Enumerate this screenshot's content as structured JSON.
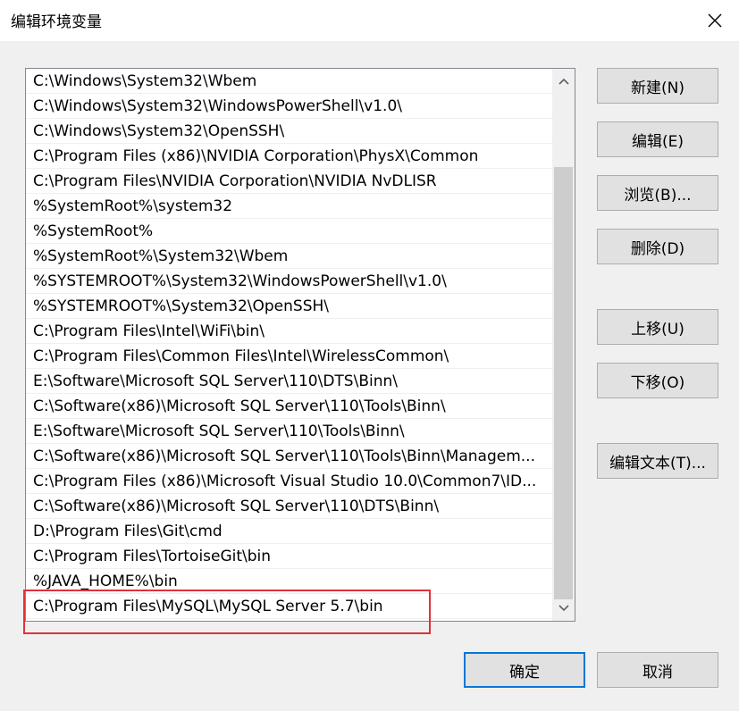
{
  "window": {
    "title": "编辑环境变量"
  },
  "path_list": {
    "entries": [
      "C:\\Windows\\System32\\Wbem",
      "C:\\Windows\\System32\\WindowsPowerShell\\v1.0\\",
      "C:\\Windows\\System32\\OpenSSH\\",
      "C:\\Program Files (x86)\\NVIDIA Corporation\\PhysX\\Common",
      "C:\\Program Files\\NVIDIA Corporation\\NVIDIA NvDLISR",
      "%SystemRoot%\\system32",
      "%SystemRoot%",
      "%SystemRoot%\\System32\\Wbem",
      "%SYSTEMROOT%\\System32\\WindowsPowerShell\\v1.0\\",
      "%SYSTEMROOT%\\System32\\OpenSSH\\",
      "C:\\Program Files\\Intel\\WiFi\\bin\\",
      "C:\\Program Files\\Common Files\\Intel\\WirelessCommon\\",
      "E:\\Software\\Microsoft SQL Server\\110\\DTS\\Binn\\",
      "C:\\Software(x86)\\Microsoft SQL Server\\110\\Tools\\Binn\\",
      "E:\\Software\\Microsoft SQL Server\\110\\Tools\\Binn\\",
      "C:\\Software(x86)\\Microsoft SQL Server\\110\\Tools\\Binn\\Managem...",
      "C:\\Program Files (x86)\\Microsoft Visual Studio 10.0\\Common7\\ID...",
      "C:\\Software(x86)\\Microsoft SQL Server\\110\\DTS\\Binn\\",
      "D:\\Program Files\\Git\\cmd",
      "C:\\Program Files\\TortoiseGit\\bin",
      "%JAVA_HOME%\\bin",
      "C:\\Program Files\\MySQL\\MySQL Server 5.7\\bin"
    ]
  },
  "buttons": {
    "new": "新建(N)",
    "edit": "编辑(E)",
    "browse": "浏览(B)...",
    "delete": "删除(D)",
    "move_up": "上移(U)",
    "move_down": "下移(O)",
    "edit_text": "编辑文本(T)...",
    "ok": "确定",
    "cancel": "取消"
  },
  "colors": {
    "highlight_border": "#e0323a",
    "primary_button_border": "#0078d7"
  },
  "icons": {
    "close": "close-icon",
    "scroll_up": "chevron-up-icon",
    "scroll_down": "chevron-down-icon"
  }
}
